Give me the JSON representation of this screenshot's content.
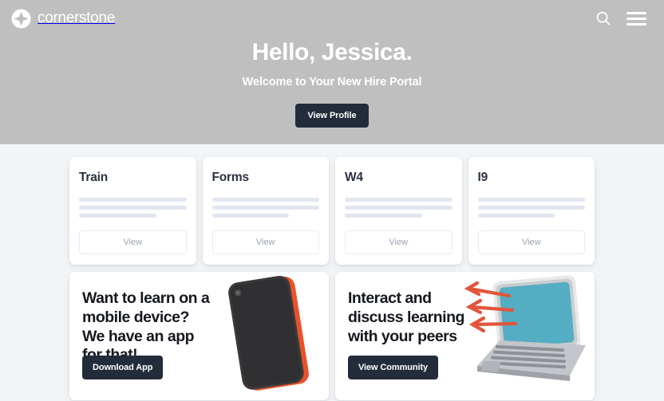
{
  "brand": {
    "name": "cornerstone",
    "logo_icon": "cornerstone-diamond-logo",
    "logo_color": "#ffffff"
  },
  "header": {
    "search_icon": "search-icon",
    "menu_icon": "hamburger-menu-icon",
    "background_color": "#bfbfbf"
  },
  "hero": {
    "title": "Hello, Jessica.",
    "subtitle": "Welcome to Your New Hire Portal",
    "cta_label": "View Profile",
    "cta_color": "#232c3b",
    "text_color": "#ffffff"
  },
  "tiles": [
    {
      "title": "Train",
      "button_label": "View"
    },
    {
      "title": "Forms",
      "button_label": "View"
    },
    {
      "title": "W4",
      "button_label": "View"
    },
    {
      "title": "I9",
      "button_label": "View"
    }
  ],
  "promos": [
    {
      "title": "Want to learn on a mobile device? We have an app for that!",
      "button_label": "Download App",
      "illustration": "mobile-phone-illustration",
      "illustration_colors": {
        "body": "#3a3a3c",
        "edge": "#e8522a"
      }
    },
    {
      "title": "Interact and discuss learning with your peers",
      "button_label": "View Community",
      "illustration": "laptop-with-arrows-illustration",
      "illustration_colors": {
        "screen": "#54adc2",
        "chassis": "#b9bcc0",
        "arrows": "#e2553a"
      }
    }
  ],
  "page": {
    "background_color": "#f2f5f7",
    "card_background": "#ffffff",
    "skeleton_color": "#e1e6f0"
  }
}
